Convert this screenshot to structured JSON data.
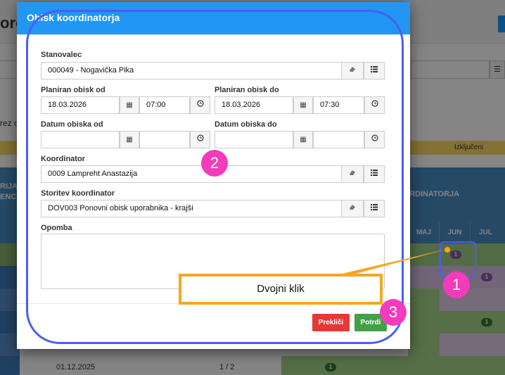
{
  "background": {
    "title_fragment": "ord",
    "rez_fragment": "rez o",
    "status_label": "Izključeni",
    "column_heading_left": "RIJA\nENC",
    "column_heading_right": "RDINATORJA",
    "months": [
      "MAJ",
      "JUN",
      "JUL"
    ],
    "row_date": "01.12.2025",
    "row_fraction": "1 / 2",
    "badge_value": "1"
  },
  "modal": {
    "title": "Obisk koordinatorja",
    "fields": {
      "resident": {
        "label": "Stanovalec",
        "value": "000049 - Nogavička Pika"
      },
      "planned_from": {
        "label": "Planiran obisk od",
        "date": "18.03.2026",
        "time": "07:00"
      },
      "planned_to": {
        "label": "Planiran obisk do",
        "date": "18.03.2026",
        "time": "07:30"
      },
      "visit_from": {
        "label": "Datum obiska od",
        "date": "",
        "time": ""
      },
      "visit_to": {
        "label": "Datum obiska do",
        "date": "",
        "time": ""
      },
      "coordinator": {
        "label": "Koordinator",
        "value": "0009 Lampreht Anastazija"
      },
      "service": {
        "label": "Storitev koordinator",
        "value": "DOV003 Ponovni obisk uporabnika - krajši"
      },
      "note": {
        "label": "Opomba",
        "value": ""
      }
    },
    "buttons": {
      "cancel": "Prekliči",
      "confirm": "Potrdi"
    }
  },
  "annotations": {
    "callout_text": "Dvojni klik",
    "step_1": "1",
    "step_2": "2",
    "step_3": "3",
    "accent_color": "#f43bbb",
    "outline_color": "#4a5ef0",
    "callout_border": "#f5a623"
  }
}
